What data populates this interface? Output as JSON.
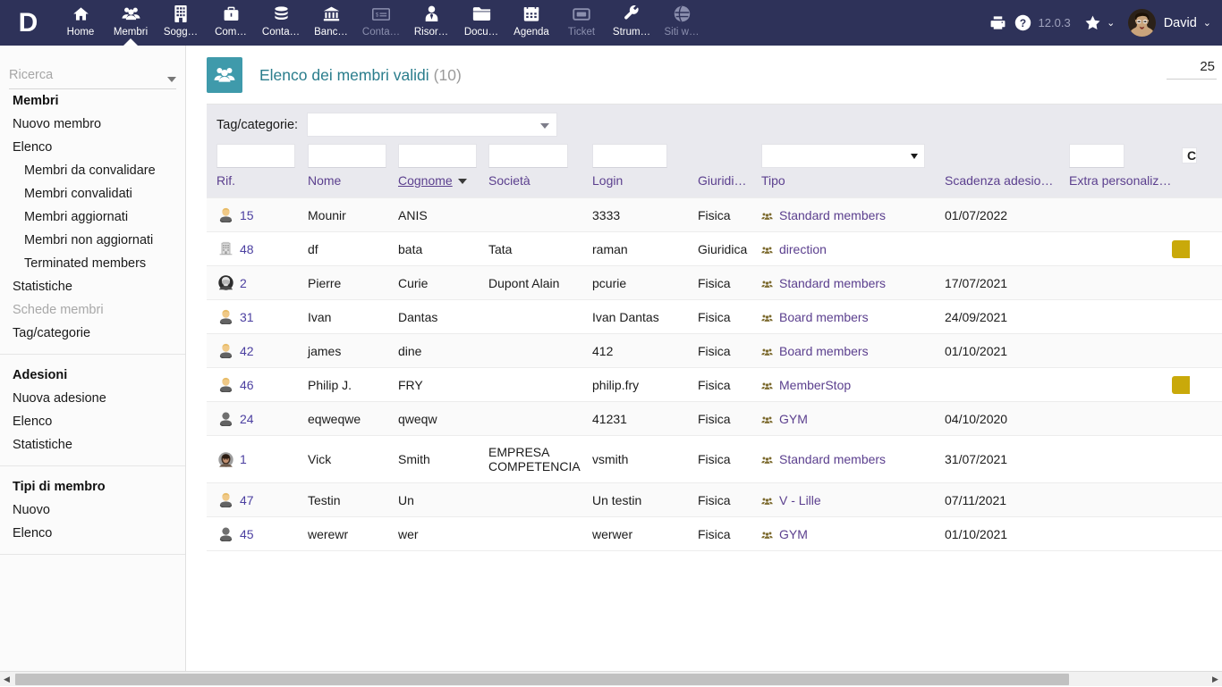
{
  "topbar": {
    "logo_text": "D",
    "nav": [
      {
        "label": "Home",
        "icon": "home-icon",
        "active": false,
        "dim": false
      },
      {
        "label": "Membri",
        "icon": "users-icon",
        "active": true,
        "dim": false
      },
      {
        "label": "Sogg…",
        "icon": "building-icon",
        "active": false,
        "dim": false
      },
      {
        "label": "Com…",
        "icon": "briefcase-icon",
        "active": false,
        "dim": false
      },
      {
        "label": "Conta…",
        "icon": "coins-icon",
        "active": false,
        "dim": false
      },
      {
        "label": "Banc…",
        "icon": "bank-icon",
        "active": false,
        "dim": false
      },
      {
        "label": "Conta…",
        "icon": "invoice-icon",
        "active": false,
        "dim": true
      },
      {
        "label": "Risor…",
        "icon": "user-tie-icon",
        "active": false,
        "dim": false
      },
      {
        "label": "Docu…",
        "icon": "folder-icon",
        "active": false,
        "dim": false
      },
      {
        "label": "Agenda",
        "icon": "calendar-icon",
        "active": false,
        "dim": false
      },
      {
        "label": "Ticket",
        "icon": "ticket-icon",
        "active": false,
        "dim": true
      },
      {
        "label": "Strum…",
        "icon": "wrench-icon",
        "active": false,
        "dim": false
      },
      {
        "label": "Siti w…",
        "icon": "globe-icon",
        "active": false,
        "dim": true
      }
    ],
    "print_icon": "printer-icon",
    "help_icon": "question-circle-icon",
    "version": "12.0.3",
    "bookmark_icon": "star-icon",
    "bookmark_caret": "⌄",
    "avatar_icon": "avatar",
    "user_name": "David",
    "user_caret": "⌄"
  },
  "sidebar": {
    "search_placeholder": "Ricerca",
    "search_value": "",
    "search_caret_icon": "chevron-down-icon",
    "sections": [
      {
        "title": "Membri",
        "items": [
          {
            "label": "Nuovo membro",
            "sub": false,
            "muted": false
          },
          {
            "label": "Elenco",
            "sub": false,
            "muted": false
          },
          {
            "label": "Membri da convalidare",
            "sub": true,
            "muted": false
          },
          {
            "label": "Membri convalidati",
            "sub": true,
            "muted": false
          },
          {
            "label": "Membri aggiornati",
            "sub": true,
            "muted": false
          },
          {
            "label": "Membri non aggiornati",
            "sub": true,
            "muted": false
          },
          {
            "label": "Terminated members",
            "sub": true,
            "muted": false
          },
          {
            "label": "Statistiche",
            "sub": false,
            "muted": false
          },
          {
            "label": "Schede membri",
            "sub": false,
            "muted": true
          },
          {
            "label": "Tag/categorie",
            "sub": false,
            "muted": false
          }
        ]
      },
      {
        "title": "Adesioni",
        "items": [
          {
            "label": "Nuova adesione",
            "sub": false,
            "muted": false
          },
          {
            "label": "Elenco",
            "sub": false,
            "muted": false
          },
          {
            "label": "Statistiche",
            "sub": false,
            "muted": false
          }
        ]
      },
      {
        "title": "Tipi di membro",
        "items": [
          {
            "label": "Nuovo",
            "sub": false,
            "muted": false
          },
          {
            "label": "Elenco",
            "sub": false,
            "muted": false
          }
        ]
      }
    ]
  },
  "page": {
    "icon": "users-group-icon",
    "title": "Elenco dei membri validi",
    "count": "(10)",
    "limit_value": "25"
  },
  "filters": {
    "tag_label": "Tag/categorie:",
    "tag_value": "",
    "tag_caret_icon": "chevron-down-icon",
    "col_ref": "",
    "col_nome": "",
    "col_cognome": "",
    "col_societa": "",
    "col_login": "",
    "col_tipo": "",
    "col_tipo_caret_icon": "caret-down-icon",
    "col_extra": "",
    "col_last": "C"
  },
  "table": {
    "columns": [
      {
        "key": "rif",
        "label": "Rif.",
        "sorted": false
      },
      {
        "key": "nome",
        "label": "Nome",
        "sorted": false
      },
      {
        "key": "cognome",
        "label": "Cognome",
        "sorted": true
      },
      {
        "key": "societa",
        "label": "Società",
        "sorted": false
      },
      {
        "key": "login",
        "label": "Login",
        "sorted": false
      },
      {
        "key": "giuridica",
        "label": "Giuridica/fisica",
        "sorted": false
      },
      {
        "key": "tipo",
        "label": "Tipo",
        "sorted": false
      },
      {
        "key": "scadenza",
        "label": "Scadenza adesio…",
        "sorted": false
      },
      {
        "key": "extra",
        "label": "Extra personalize…",
        "sorted": false
      }
    ],
    "sort_caret_icon": "caret-down-icon",
    "rows": [
      {
        "avatar": "person-blond",
        "rif": "15",
        "nome": "Mounir",
        "cognome": "ANIS",
        "societa": "",
        "login": "3333",
        "giuridica": "Fisica",
        "tipo": "Standard members",
        "scadenza": "01/07/2022",
        "badge": false
      },
      {
        "avatar": "company",
        "rif": "48",
        "nome": "df",
        "cognome": "bata",
        "societa": "Tata",
        "login": "raman",
        "giuridica": "Giuridica",
        "tipo": "direction",
        "scadenza": "",
        "badge": true
      },
      {
        "avatar": "photo-man",
        "rif": "2",
        "nome": "Pierre",
        "cognome": "Curie",
        "societa": "Dupont Alain",
        "login": "pcurie",
        "giuridica": "Fisica",
        "tipo": "Standard members",
        "scadenza": "17/07/2021",
        "badge": false
      },
      {
        "avatar": "person-blond",
        "rif": "31",
        "nome": "Ivan",
        "cognome": "Dantas",
        "societa": "",
        "login": "Ivan Dantas",
        "giuridica": "Fisica",
        "tipo": "Board members",
        "scadenza": "24/09/2021",
        "badge": false
      },
      {
        "avatar": "person-blond",
        "rif": "42",
        "nome": "james",
        "cognome": "dine",
        "societa": "",
        "login": "412",
        "giuridica": "Fisica",
        "tipo": "Board members",
        "scadenza": "01/10/2021",
        "badge": false
      },
      {
        "avatar": "person-blond",
        "rif": "46",
        "nome": "Philip J.",
        "cognome": "FRY",
        "societa": "",
        "login": "philip.fry",
        "giuridica": "Fisica",
        "tipo": "MemberStop",
        "scadenza": "",
        "badge": true
      },
      {
        "avatar": "person-grey",
        "rif": "24",
        "nome": "eqweqwe",
        "cognome": "qweqw",
        "societa": "",
        "login": "41231",
        "giuridica": "Fisica",
        "tipo": "GYM",
        "scadenza": "04/10/2020",
        "badge": false
      },
      {
        "avatar": "photo-woman",
        "rif": "1",
        "nome": "Vick",
        "cognome": "Smith",
        "societa": "EMPRESA COMPETENCIA",
        "login": "vsmith",
        "giuridica": "Fisica",
        "tipo": "Standard members",
        "scadenza": "31/07/2021",
        "badge": false
      },
      {
        "avatar": "person-blond",
        "rif": "47",
        "nome": "Testin",
        "cognome": "Un",
        "societa": "",
        "login": "Un testin",
        "giuridica": "Fisica",
        "tipo": "V - Lille",
        "scadenza": "07/11/2021",
        "badge": false
      },
      {
        "avatar": "person-grey",
        "rif": "45",
        "nome": "werewr",
        "cognome": "wer",
        "societa": "",
        "login": "werwer",
        "giuridica": "Fisica",
        "tipo": "GYM",
        "scadenza": "01/10/2021",
        "badge": false
      }
    ]
  },
  "scrollbar": {
    "left_arrow": "◀",
    "right_arrow": "▶"
  },
  "colors": {
    "topbar": "#2e3259",
    "accent_teal": "#3f9aab",
    "link_purple": "#5b3f8e",
    "badge_yellow": "#c9a90a",
    "filter_bg": "#e9e9ee"
  }
}
